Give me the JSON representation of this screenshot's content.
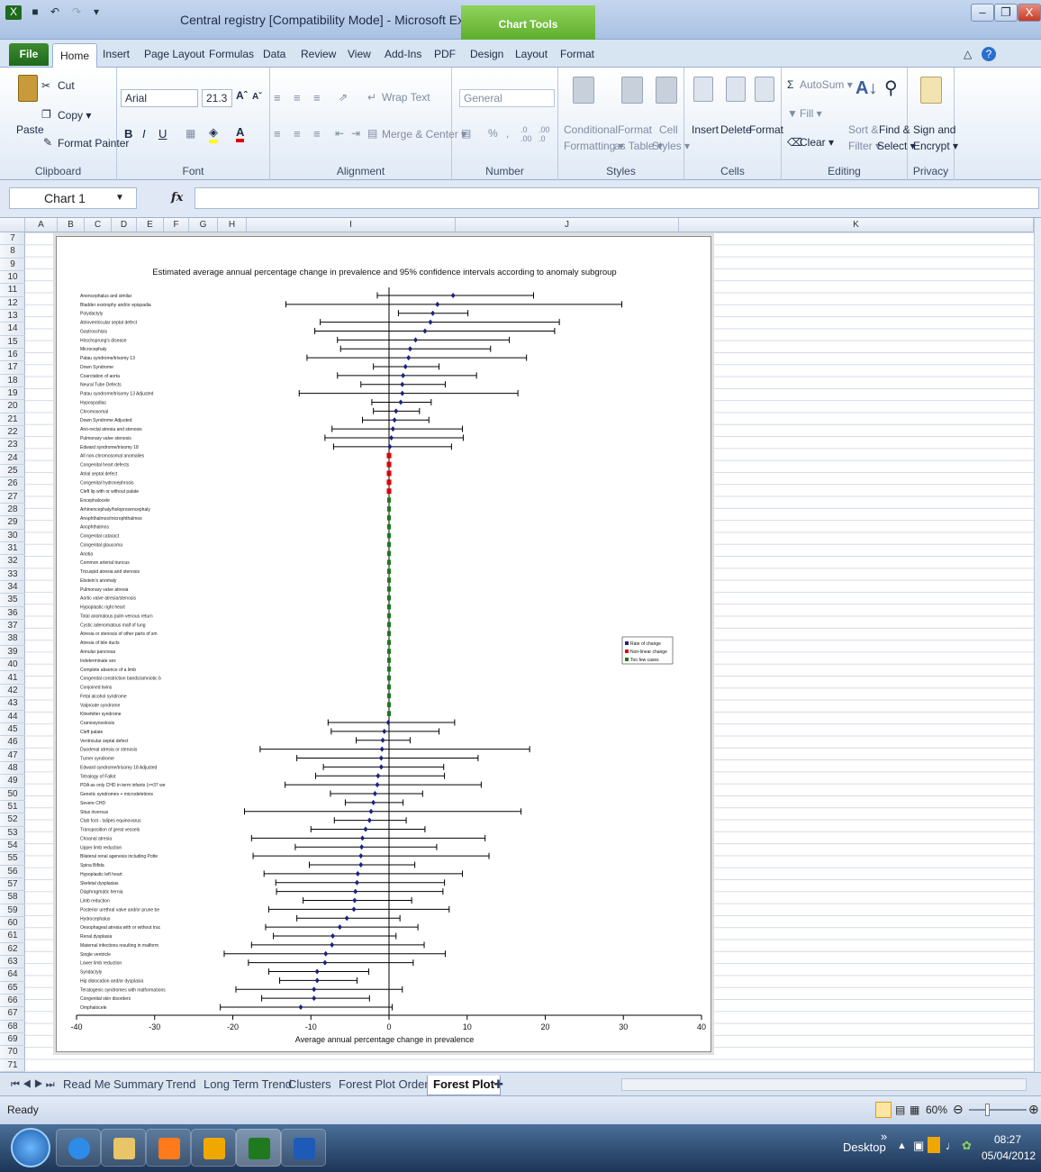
{
  "window": {
    "title": "Central registry  [Compatibility Mode]  -  Microsoft Excel",
    "context_tab": "Chart Tools"
  },
  "ribbon_tabs": [
    "File",
    "Home",
    "Insert",
    "Page Layout",
    "Formulas",
    "Data",
    "Review",
    "View",
    "Add-Ins",
    "PDF",
    "Design",
    "Layout",
    "Format"
  ],
  "ribbon": {
    "clipboard": {
      "label": "Clipboard",
      "paste": "Paste",
      "cut": "Cut",
      "copy": "Copy ▾",
      "format_painter": "Format Painter"
    },
    "font": {
      "label": "Font",
      "name": "Arial",
      "size": "21.3"
    },
    "alignment": {
      "label": "Alignment",
      "wrap": "Wrap Text",
      "merge": "Merge & Center ▾"
    },
    "number": {
      "label": "Number",
      "format": "General"
    },
    "styles": {
      "label": "Styles",
      "cond1": "Conditional",
      "cond2": "Formatting ▾",
      "fmt1": "Format",
      "fmt2": "as Table ▾",
      "cell1": "Cell",
      "cell2": "Styles ▾"
    },
    "cells": {
      "label": "Cells",
      "insert": "Insert",
      "delete": "Delete",
      "format": "Format"
    },
    "editing": {
      "label": "Editing",
      "autosum": "AutoSum ▾",
      "fill": "Fill ▾",
      "clear": "Clear ▾",
      "sort1": "Sort &",
      "sort2": "Filter ▾",
      "find1": "Find &",
      "find2": "Select ▾"
    },
    "privacy": {
      "label": "Privacy",
      "sign1": "Sign and",
      "sign2": "Encrypt ▾"
    }
  },
  "formula_bar": {
    "name_box": "Chart 1",
    "fx": "fx",
    "value": ""
  },
  "columns": [
    "A",
    "B",
    "C",
    "D",
    "E",
    "F",
    "G",
    "H",
    "I",
    "J",
    "K"
  ],
  "row_start": 7,
  "row_end": 71,
  "sheet_tabs": [
    "Read Me",
    "Summary",
    "Trend",
    "Long Term Trend",
    "Clusters",
    "Forest Plot Ordered",
    "Forest Plot"
  ],
  "active_sheet": "Forest Plot",
  "status": {
    "ready": "Ready",
    "zoom": "60%"
  },
  "taskbar": {
    "desktop": "Desktop",
    "time": "08:27",
    "date": "05/04/2012"
  },
  "colors": {
    "rate": "#1a237e",
    "nonlinear": "#e00000",
    "few": "#1b7a1b"
  },
  "chart_data": {
    "type": "forest",
    "title": "Estimated average annual percentage change in prevalence and 95% confidence intervals according to anomaly subgroup",
    "xlabel": "Average annual percentage change in prevalence",
    "xlim": [
      -40,
      40
    ],
    "xticks": [
      -40,
      -30,
      -20,
      -10,
      0,
      10,
      20,
      30,
      40
    ],
    "legend": [
      "Rate of change",
      "Non-linear change",
      "Too few cases"
    ],
    "legend_position": "right",
    "rows": [
      {
        "label": "Anencephalus and similar",
        "est": 8.2,
        "lo": -1.5,
        "hi": 18.5,
        "kind": "rate"
      },
      {
        "label": "Bladder exstrophy and/or epispadia",
        "est": 6.2,
        "lo": -13.2,
        "hi": 29.8,
        "kind": "rate"
      },
      {
        "label": "Polydactyly",
        "est": 5.6,
        "lo": 1.2,
        "hi": 10.1,
        "kind": "rate"
      },
      {
        "label": "Atrioventricular septal defect",
        "est": 5.3,
        "lo": -8.8,
        "hi": 21.8,
        "kind": "rate"
      },
      {
        "label": "Gastroschisis",
        "est": 4.6,
        "lo": -9.5,
        "hi": 21.2,
        "kind": "rate"
      },
      {
        "label": "Hirschsprung's disease",
        "est": 3.4,
        "lo": -6.6,
        "hi": 15.4,
        "kind": "rate"
      },
      {
        "label": "Microcephaly",
        "est": 2.7,
        "lo": -6.2,
        "hi": 13.0,
        "kind": "rate"
      },
      {
        "label": "Patau syndrome/trisomy 13",
        "est": 2.5,
        "lo": -10.5,
        "hi": 17.6,
        "kind": "rate"
      },
      {
        "label": "Down Syndrome",
        "est": 2.1,
        "lo": -2.0,
        "hi": 6.4,
        "kind": "rate"
      },
      {
        "label": "Coarctation of aorta",
        "est": 1.8,
        "lo": -6.6,
        "hi": 11.2,
        "kind": "rate"
      },
      {
        "label": "Neural Tube Defects",
        "est": 1.7,
        "lo": -3.6,
        "hi": 7.2,
        "kind": "rate"
      },
      {
        "label": "Patau syndrome/trisomy 13 Adjusted",
        "est": 1.7,
        "lo": -11.5,
        "hi": 16.5,
        "kind": "rate"
      },
      {
        "label": "Hypospadias",
        "est": 1.5,
        "lo": -2.2,
        "hi": 5.4,
        "kind": "rate"
      },
      {
        "label": "Chromosomal",
        "est": 0.9,
        "lo": -2.0,
        "hi": 3.9,
        "kind": "rate"
      },
      {
        "label": "Down Syndrome Adjusted",
        "est": 0.7,
        "lo": -3.4,
        "hi": 5.1,
        "kind": "rate"
      },
      {
        "label": "Ano-rectal atresia and stenosis",
        "est": 0.5,
        "lo": -7.3,
        "hi": 9.4,
        "kind": "rate"
      },
      {
        "label": "Pulmonary valve stenosis",
        "est": 0.3,
        "lo": -8.2,
        "hi": 9.5,
        "kind": "rate"
      },
      {
        "label": "Edward syndrome/trisomy 18",
        "est": 0.1,
        "lo": -7.1,
        "hi": 8.0,
        "kind": "rate"
      },
      {
        "label": "All non-chromosomal anomalies",
        "kind": "nonlinear"
      },
      {
        "label": "Congenital heart defects",
        "kind": "nonlinear"
      },
      {
        "label": "Atrial septal defect",
        "kind": "nonlinear"
      },
      {
        "label": "Congenital hydronephrosis",
        "kind": "nonlinear"
      },
      {
        "label": "Cleft lip with or without palate",
        "kind": "nonlinear"
      },
      {
        "label": "Encephalocele",
        "kind": "few"
      },
      {
        "label": "Arhinencephaly/holoprosencephaly",
        "kind": "few"
      },
      {
        "label": "Anophthalmos/microphthalmos",
        "kind": "few"
      },
      {
        "label": "Anophthalmos",
        "kind": "few"
      },
      {
        "label": "Congenital cataract",
        "kind": "few"
      },
      {
        "label": "Congenital glaucoma",
        "kind": "few"
      },
      {
        "label": "Anotia",
        "kind": "few"
      },
      {
        "label": "Common arterial truncus",
        "kind": "few"
      },
      {
        "label": "Tricuspid atresia and stenosis",
        "kind": "few"
      },
      {
        "label": "Ebstein's anomaly",
        "kind": "few"
      },
      {
        "label": "Pulmonary valve atresia",
        "kind": "few"
      },
      {
        "label": "Aortic valve atresia/stenosis",
        "kind": "few"
      },
      {
        "label": "Hypoplastic right heart",
        "kind": "few"
      },
      {
        "label": "Total anomalous pulm venous return",
        "kind": "few"
      },
      {
        "label": "Cystic adenomatous malf of lung",
        "kind": "few"
      },
      {
        "label": "Atresia or stenosis of other parts of sm",
        "kind": "few"
      },
      {
        "label": "Atresia of bile ducts",
        "kind": "few"
      },
      {
        "label": "Annular pancreas",
        "kind": "few"
      },
      {
        "label": "Indeterminate sex",
        "kind": "few"
      },
      {
        "label": "Complete absence of a limb",
        "kind": "few"
      },
      {
        "label": "Congenital constriction bands/amniotic b",
        "kind": "few"
      },
      {
        "label": "Conjoined twins",
        "kind": "few"
      },
      {
        "label": "Fetal alcohol syndrome",
        "kind": "few"
      },
      {
        "label": "Valproate syndrome",
        "kind": "few"
      },
      {
        "label": "Klinefelter syndrome",
        "kind": "few"
      },
      {
        "label": "Craniosynostosis",
        "est": -0.1,
        "lo": -7.8,
        "hi": 8.4,
        "kind": "rate"
      },
      {
        "label": "Cleft palate",
        "est": -0.6,
        "lo": -7.4,
        "hi": 6.4,
        "kind": "rate"
      },
      {
        "label": "Ventricular septal defect",
        "est": -0.8,
        "lo": -4.2,
        "hi": 2.7,
        "kind": "rate"
      },
      {
        "label": "Duodenal atresia or stenosis",
        "est": -0.9,
        "lo": -16.5,
        "hi": 18.0,
        "kind": "rate"
      },
      {
        "label": "Turner syndrome",
        "est": -1.0,
        "lo": -11.8,
        "hi": 11.4,
        "kind": "rate"
      },
      {
        "label": "Edward syndrome/trisomy 18 Adjusted",
        "est": -1.0,
        "lo": -8.4,
        "hi": 7.0,
        "kind": "rate"
      },
      {
        "label": "Tetralogy of Fallot",
        "est": -1.4,
        "lo": -9.4,
        "hi": 7.1,
        "kind": "rate"
      },
      {
        "label": "PDA as only CHD in term infants (>=37 we",
        "est": -1.5,
        "lo": -13.3,
        "hi": 11.8,
        "kind": "rate"
      },
      {
        "label": "Genetic syndromes + microdeletions",
        "est": -1.8,
        "lo": -7.5,
        "hi": 4.3,
        "kind": "rate"
      },
      {
        "label": "Severe CHD",
        "est": -2.0,
        "lo": -5.6,
        "hi": 1.8,
        "kind": "rate"
      },
      {
        "label": "Situs inversus",
        "est": -2.3,
        "lo": -18.5,
        "hi": 16.9,
        "kind": "rate"
      },
      {
        "label": "Club foot - talipes equinovarus",
        "est": -2.5,
        "lo": -7.0,
        "hi": 2.2,
        "kind": "rate"
      },
      {
        "label": "Transposition of great vessels",
        "est": -3.0,
        "lo": -10.0,
        "hi": 4.6,
        "kind": "rate"
      },
      {
        "label": "Choanal atresia",
        "est": -3.4,
        "lo": -17.6,
        "hi": 12.3,
        "kind": "rate"
      },
      {
        "label": "Upper limb reduction",
        "est": -3.5,
        "lo": -12.0,
        "hi": 6.1,
        "kind": "rate"
      },
      {
        "label": "Bilateral renal agenesis including Potte",
        "est": -3.6,
        "lo": -17.4,
        "hi": 12.8,
        "kind": "rate"
      },
      {
        "label": "Spina Bifida",
        "est": -3.6,
        "lo": -10.2,
        "hi": 3.3,
        "kind": "rate"
      },
      {
        "label": "Hypoplastic left heart",
        "est": -4.0,
        "lo": -16.0,
        "hi": 9.4,
        "kind": "rate"
      },
      {
        "label": "Skeletal dysplasias",
        "est": -4.1,
        "lo": -14.5,
        "hi": 7.1,
        "kind": "rate"
      },
      {
        "label": "Diaphragmatic hernia",
        "est": -4.3,
        "lo": -14.4,
        "hi": 6.9,
        "kind": "rate"
      },
      {
        "label": "Limb reduction",
        "est": -4.4,
        "lo": -11.0,
        "hi": 2.9,
        "kind": "rate"
      },
      {
        "label": "Posterior urethral valve and/or prune be",
        "est": -4.5,
        "lo": -15.4,
        "hi": 7.7,
        "kind": "rate"
      },
      {
        "label": "Hydrocephalus",
        "est": -5.4,
        "lo": -11.8,
        "hi": 1.4,
        "kind": "rate"
      },
      {
        "label": "Oesophageal atresia with or without trac",
        "est": -6.3,
        "lo": -15.8,
        "hi": 3.7,
        "kind": "rate"
      },
      {
        "label": "Renal dysplasia",
        "est": -7.2,
        "lo": -14.8,
        "hi": 0.9,
        "kind": "rate"
      },
      {
        "label": "Maternal infections resulting in malform",
        "est": -7.3,
        "lo": -17.6,
        "hi": 4.5,
        "kind": "rate"
      },
      {
        "label": "Single ventricle",
        "est": -8.1,
        "lo": -21.1,
        "hi": 7.2,
        "kind": "rate"
      },
      {
        "label": "Lower limb reduction",
        "est": -8.2,
        "lo": -18.0,
        "hi": 3.1,
        "kind": "rate"
      },
      {
        "label": "Syndactyly",
        "est": -9.2,
        "lo": -15.4,
        "hi": -2.6,
        "kind": "rate"
      },
      {
        "label": "Hip dislocation and/or dysplasia",
        "est": -9.2,
        "lo": -14.0,
        "hi": -4.1,
        "kind": "rate"
      },
      {
        "label": "Teratogenic syndromes with malformations",
        "est": -9.6,
        "lo": -19.6,
        "hi": 1.7,
        "kind": "rate"
      },
      {
        "label": "Congenital skin disorders",
        "est": -9.6,
        "lo": -16.3,
        "hi": -2.5,
        "kind": "rate"
      },
      {
        "label": "Omphalocele",
        "est": -11.3,
        "lo": -21.6,
        "hi": 0.4,
        "kind": "rate"
      }
    ]
  }
}
